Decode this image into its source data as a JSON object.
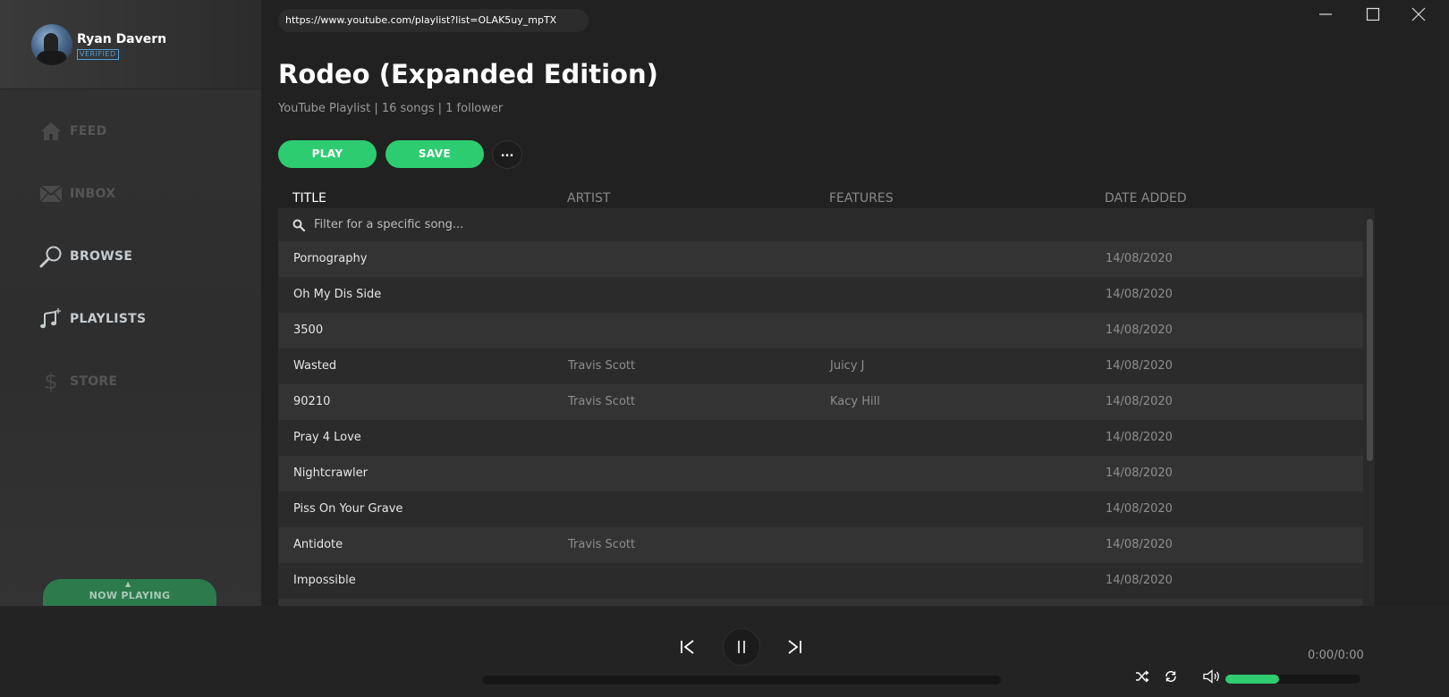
{
  "user": {
    "name": "Ryan Davern",
    "badge": "VERIFIED"
  },
  "nav": [
    {
      "label": "FEED",
      "icon": "home-icon",
      "active": false
    },
    {
      "label": "INBOX",
      "icon": "mail-icon",
      "active": false
    },
    {
      "label": "BROWSE",
      "icon": "search-icon",
      "active": true
    },
    {
      "label": "PLAYLISTS",
      "icon": "music-note-icon",
      "active": true
    },
    {
      "label": "STORE",
      "icon": "dollar-icon",
      "active": false
    }
  ],
  "now_playing_label": "NOW PLAYING",
  "url": "https://www.youtube.com/playlist?list=OLAK5uy_mpTX",
  "playlist": {
    "title": "Rodeo (Expanded Edition)",
    "subtitle": "YouTube Playlist | 16 songs | 1 follower",
    "play_label": "PLAY",
    "save_label": "SAVE",
    "more_label": "..."
  },
  "columns": [
    "TITLE",
    "ARTIST",
    "FEATURES",
    "DATE ADDED"
  ],
  "filter_placeholder": "Filter for a specific song...",
  "songs": [
    {
      "title": "Pornography",
      "artist": "",
      "features": "",
      "date": "14/08/2020"
    },
    {
      "title": "Oh My Dis Side",
      "artist": "",
      "features": "",
      "date": "14/08/2020"
    },
    {
      "title": "3500",
      "artist": "",
      "features": "",
      "date": "14/08/2020"
    },
    {
      "title": "Wasted",
      "artist": "Travis Scott",
      "features": "Juicy J",
      "date": "14/08/2020"
    },
    {
      "title": "90210",
      "artist": "Travis Scott",
      "features": "Kacy Hill",
      "date": "14/08/2020"
    },
    {
      "title": "Pray 4 Love",
      "artist": "",
      "features": "",
      "date": "14/08/2020"
    },
    {
      "title": "Nightcrawler",
      "artist": "",
      "features": "",
      "date": "14/08/2020"
    },
    {
      "title": "Piss On Your Grave",
      "artist": "",
      "features": "",
      "date": "14/08/2020"
    },
    {
      "title": "Antidote",
      "artist": "Travis Scott",
      "features": "",
      "date": "14/08/2020"
    },
    {
      "title": "Impossible",
      "artist": "",
      "features": "",
      "date": "14/08/2020"
    },
    {
      "title": "",
      "artist": "",
      "features": "",
      "date": ""
    }
  ],
  "player": {
    "time": "0:00/0:00",
    "progress": 0,
    "volume": 0.4
  },
  "colors": {
    "accent": "#2ecc71",
    "background": "#212121",
    "sidebar": "#2e2e2e"
  }
}
